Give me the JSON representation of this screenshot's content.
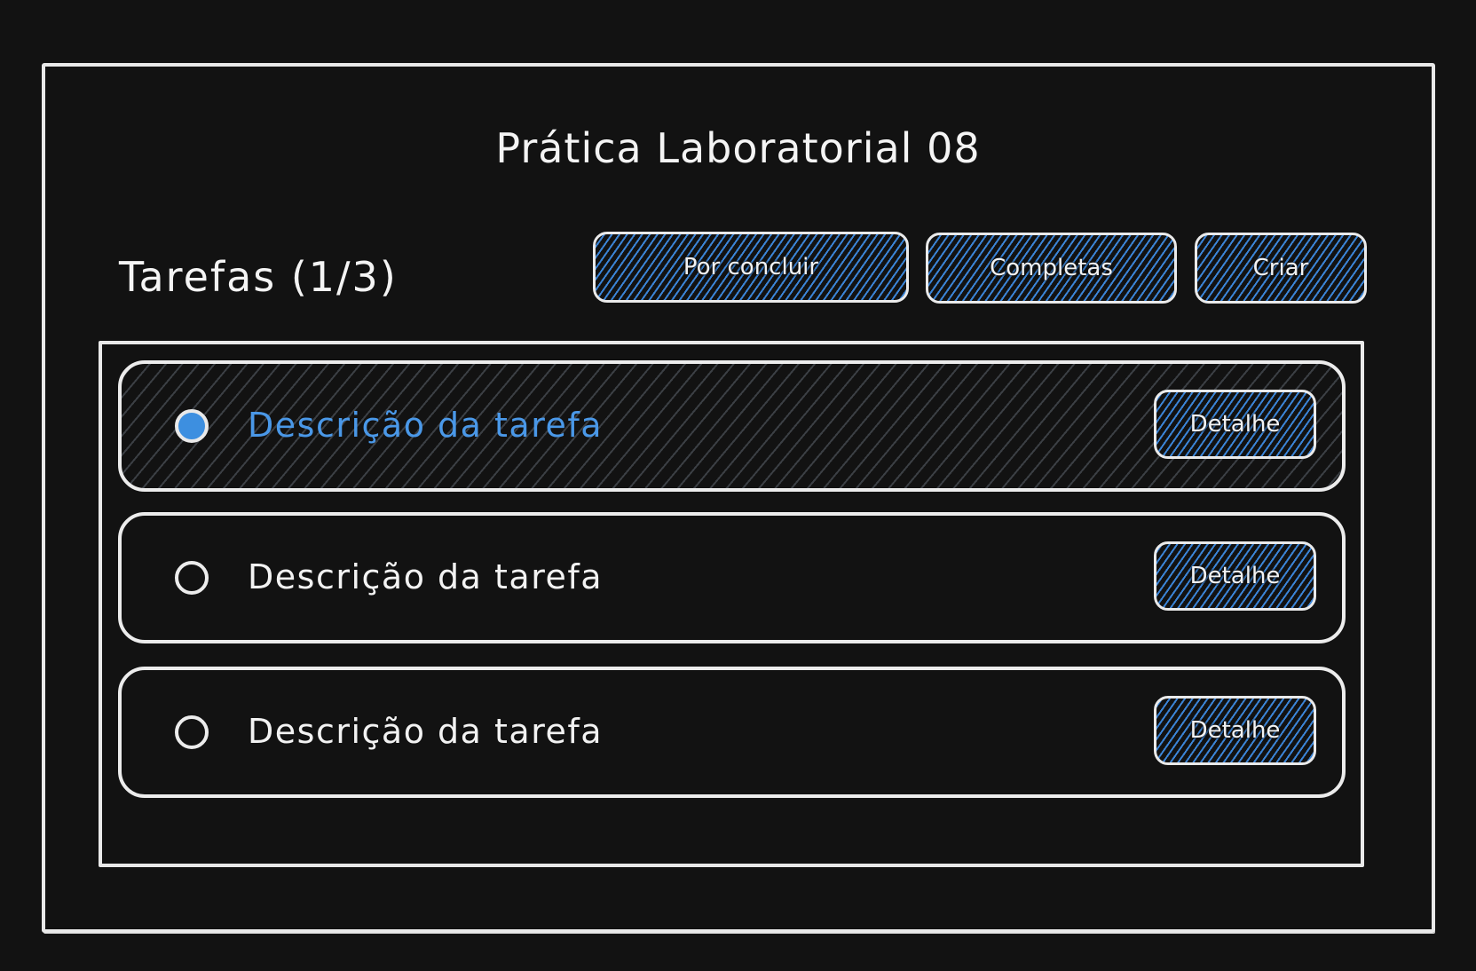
{
  "header": {
    "title": "Prática Laboratorial 08",
    "section_title": "Tarefas (1/3)"
  },
  "toolbar": {
    "pending_label": "Por concluir",
    "complete_label": "Completas",
    "create_label": "Criar"
  },
  "tasks": [
    {
      "description": "Descrição da tarefa",
      "checked": true,
      "detail_label": "Detalhe"
    },
    {
      "description": "Descrição da tarefa",
      "checked": false,
      "detail_label": "Detalhe"
    },
    {
      "description": "Descrição da tarefa",
      "checked": false,
      "detail_label": "Detalhe"
    }
  ],
  "colors": {
    "background": "#121212",
    "stroke": "#ececec",
    "accent": "#3b84d6",
    "selected_text": "#4a98e8"
  }
}
